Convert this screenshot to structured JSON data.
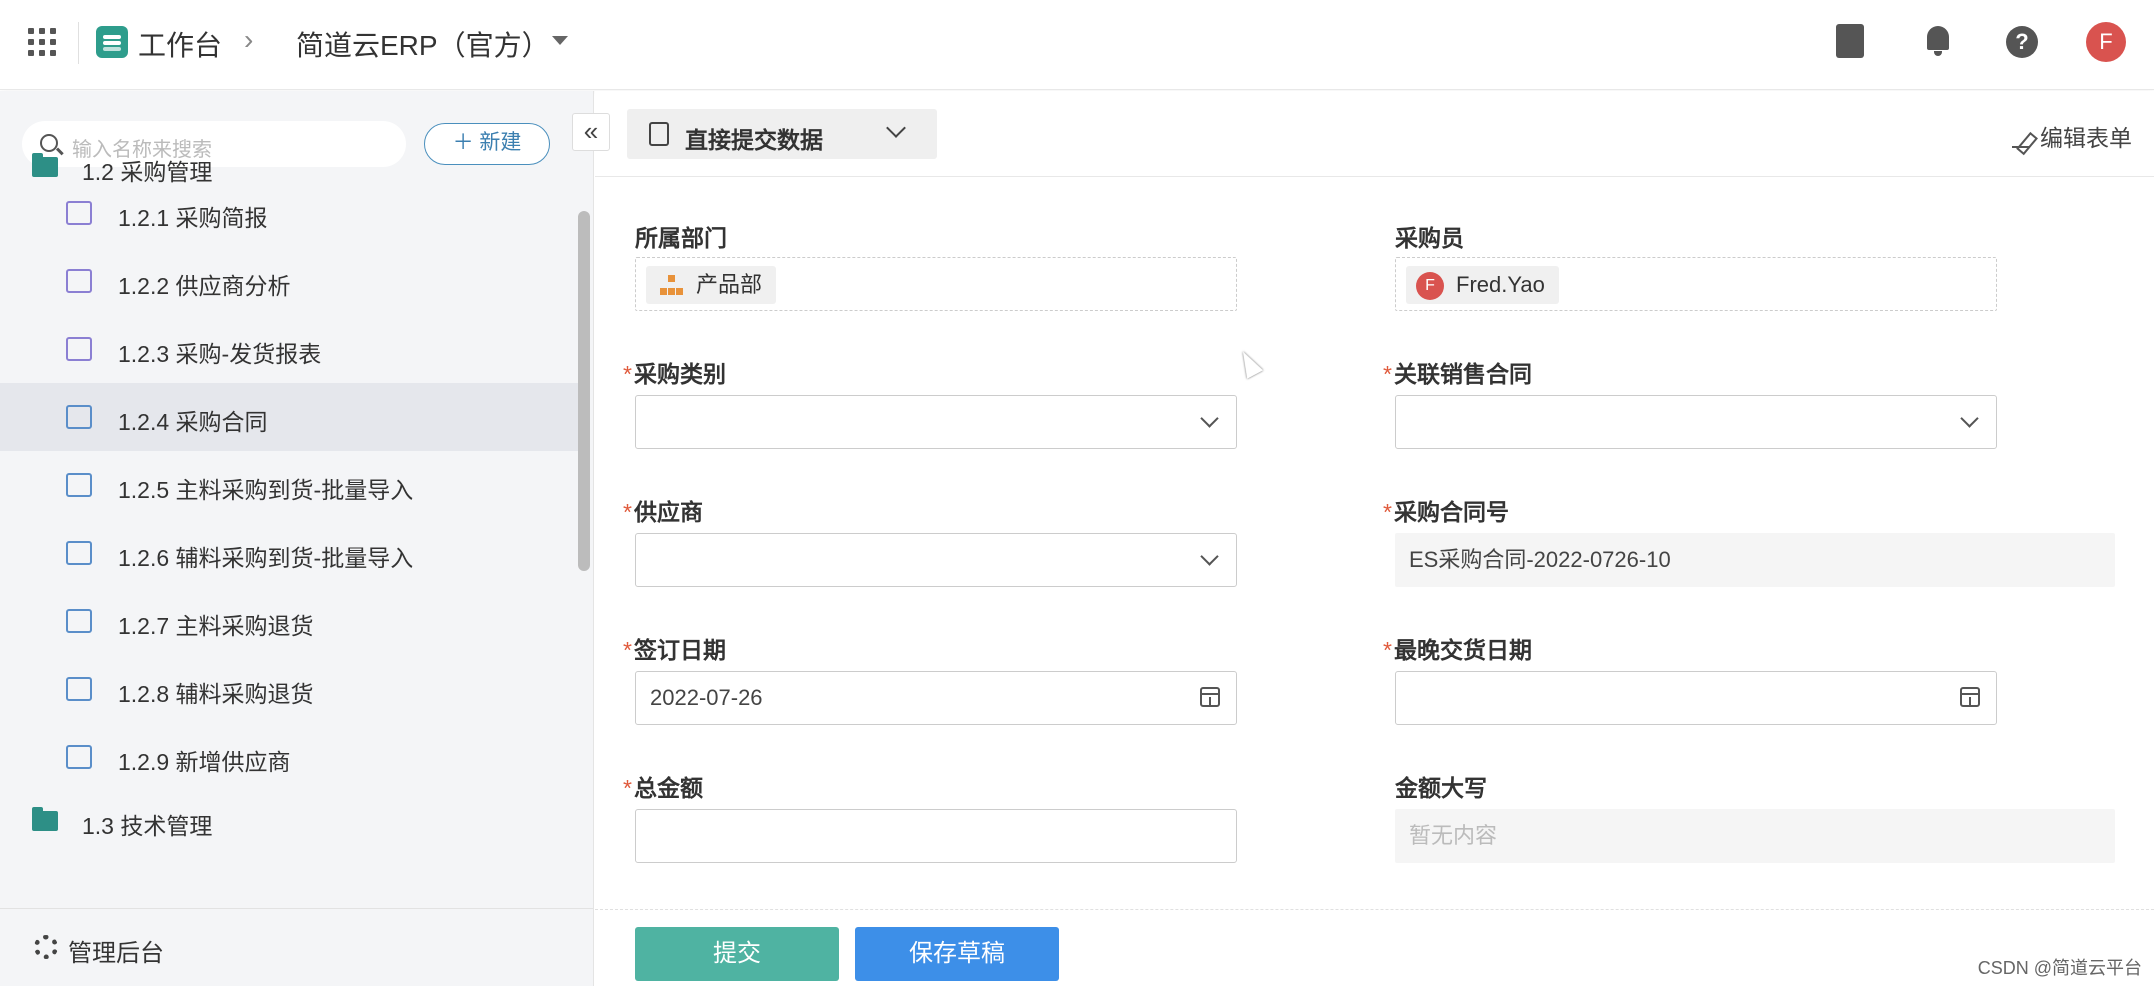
{
  "topbar": {
    "brand": "工作台",
    "crumb_sep": "›",
    "app_name": "简道云ERP（官方）",
    "avatar_letter": "F"
  },
  "sidebar": {
    "search_placeholder": "输入名称来搜索",
    "new_label": "新建",
    "collapse_glyph": "«",
    "groups": [
      {
        "label": "1.2 采购管理"
      },
      {
        "label": "1.3 技术管理"
      }
    ],
    "items": [
      {
        "label": "1.2.1 采购简报",
        "icon": "dashboard-icon"
      },
      {
        "label": "1.2.2 供应商分析",
        "icon": "dashboard-icon"
      },
      {
        "label": "1.2.3 采购-发货报表",
        "icon": "cart-icon"
      },
      {
        "label": "1.2.4 采购合同",
        "icon": "contract-icon"
      },
      {
        "label": "1.2.5 主料采购到货-批量导入",
        "icon": "stamp-icon"
      },
      {
        "label": "1.2.6 辅料采购到货-批量导入",
        "icon": "form-icon"
      },
      {
        "label": "1.2.7 主料采购退货",
        "icon": "alarm-icon"
      },
      {
        "label": "1.2.8 辅料采购退货",
        "icon": "alarm-icon"
      },
      {
        "label": "1.2.9 新增供应商",
        "icon": "user-icon"
      }
    ],
    "admin_label": "管理后台"
  },
  "toolbar": {
    "submit_mode": "直接提交数据",
    "edit_form": "编辑表单"
  },
  "form": {
    "dept_label": "所属部门",
    "dept_value": "产品部",
    "buyer_label": "采购员",
    "buyer_value": "Fred.Yao",
    "buyer_avatar": "F",
    "category_label": "采购类别",
    "contract_link_label": "关联销售合同",
    "supplier_label": "供应商",
    "contract_no_label": "采购合同号",
    "contract_no_value": "ES采购合同-2022-0726-10",
    "sign_date_label": "签订日期",
    "sign_date_value": "2022-07-26",
    "delivery_date_label": "最晚交货日期",
    "total_label": "总金额",
    "amount_caps_label": "金额大写",
    "amount_caps_value": "暂无内容",
    "required_mark": "*"
  },
  "footer": {
    "submit": "提交",
    "save_draft": "保存草稿",
    "watermark": "CSDN @简道云平台"
  },
  "colors": {
    "accent_teal": "#4fb3a2",
    "accent_blue": "#3d8fe8",
    "required": "#e05a3c"
  }
}
